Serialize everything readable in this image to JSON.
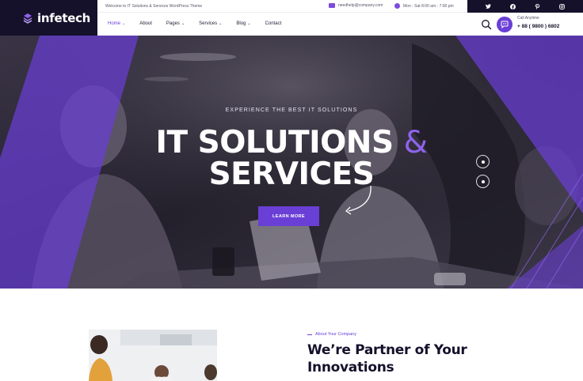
{
  "brand": {
    "name": "infetech",
    "primary_color": "#6a3fd6",
    "dark_color": "#15112b"
  },
  "topbar": {
    "welcome": "Welcome to IT Solutions & Services WordPress Theme",
    "email": "needhelp@company.com",
    "hours": "Mon - Sat 8:00 am - 7:00 pm",
    "socials": [
      "twitter-icon",
      "facebook-icon",
      "pinterest-icon",
      "instagram-icon"
    ]
  },
  "nav": {
    "items": [
      {
        "label": "Home",
        "dropdown": true,
        "active": true
      },
      {
        "label": "About",
        "dropdown": false
      },
      {
        "label": "Pages",
        "dropdown": true
      },
      {
        "label": "Services",
        "dropdown": true
      },
      {
        "label": "Blog",
        "dropdown": true
      },
      {
        "label": "Contact",
        "dropdown": false
      }
    ],
    "call_label": "Call Anytime",
    "call_number": "+ 88 ( 9800 ) 6802"
  },
  "hero": {
    "eyebrow": "EXPERIENCE THE BEST IT SOLUTIONS",
    "title_line1": "IT SOLUTIONS",
    "title_amp": "&",
    "title_line2": "SERVICES",
    "button": "LEARN MORE"
  },
  "about": {
    "eyebrow": "About Your Company",
    "heading": "We’re Partner of Your Innovations"
  }
}
